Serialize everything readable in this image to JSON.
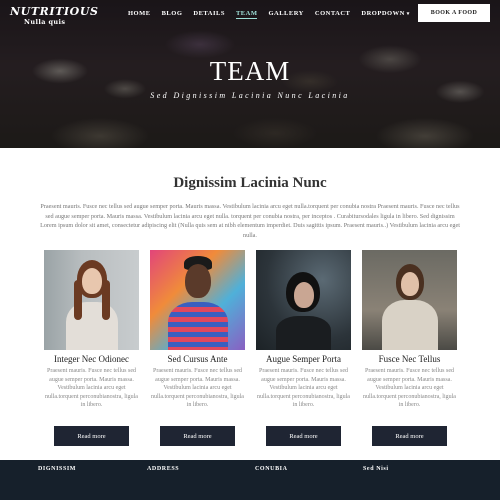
{
  "brand": {
    "title": "NUTRITIOUS",
    "subtitle": "Nulla quis"
  },
  "nav": {
    "items": [
      {
        "label": "HOME",
        "active": false
      },
      {
        "label": "BLOG",
        "active": false
      },
      {
        "label": "DETAILS",
        "active": false
      },
      {
        "label": "TEAM",
        "active": true
      },
      {
        "label": "GALLERY",
        "active": false
      },
      {
        "label": "CONTACT",
        "active": false
      },
      {
        "label": "DROPDOWN",
        "active": false
      }
    ],
    "dropdown_caret": "▾",
    "book_label": "BOOK A FOOD"
  },
  "hero": {
    "title": "TEAM",
    "subtitle": "Sed Dignissim Lacinia Nunc Lacinia"
  },
  "intro": {
    "title": "Dignissim Lacinia Nunc",
    "text": "Praesent mauris. Fusce nec tellus sed augue semper porta. Mauris massa. Vestibulum lacinia arcu eget nulla.torquent per conubia nostra Praesent mauris. Fusce nec tellus sed augue semper porta. Mauris massa. Vestibulum lacinia arcu eget nulla. torquent per conubia nostra, per inceptos . Curabitursodales ligula in libero. Sed dignissim Lorem ipsum dolor sit amet, consectetur adipiscing elit (Nulla quis sem at nibh elementum imperdiet. Duis sagittis ipsum. Praesent mauris..) Vestibulum lacinia arcu eget nulla."
  },
  "team": [
    {
      "name": "Integer Nec Odionec",
      "text": "Praesent mauris. Fusce nec tellus sed augue semper porta. Mauris massa. Vestibulum lacinia arcu eget nulla.torquent perconubianostra, ligula in libero.",
      "button": "Read more"
    },
    {
      "name": "Sed Cursus Ante",
      "text": "Praesent mauris. Fusce nec tellus sed augue semper porta. Mauris massa. Vestibulum lacinia arcu eget nulla.torquent perconubianostra, ligula in libero.",
      "button": "Read more"
    },
    {
      "name": "Augue Semper Porta",
      "text": "Praesent mauris. Fusce nec tellus sed augue semper porta. Mauris massa. Vestibulum lacinia arcu eget nulla.torquent perconubianostra, ligula in libero.",
      "button": "Read more"
    },
    {
      "name": "Fusce Nec Tellus",
      "text": "Praesent mauris. Fusce nec tellus sed augue semper porta. Mauris massa. Vestibulum lacinia arcu eget nulla.torquent perconubianostra, ligula in libero.",
      "button": "Read more"
    }
  ],
  "footer": {
    "columns": [
      "DIGNISSIM",
      "ADDRESS",
      "CONUBIA",
      "Sed Nisi"
    ]
  },
  "colors": {
    "button_dark": "#1f2533",
    "footer_bg": "#16202b",
    "active_nav": "#9fe0d8"
  }
}
